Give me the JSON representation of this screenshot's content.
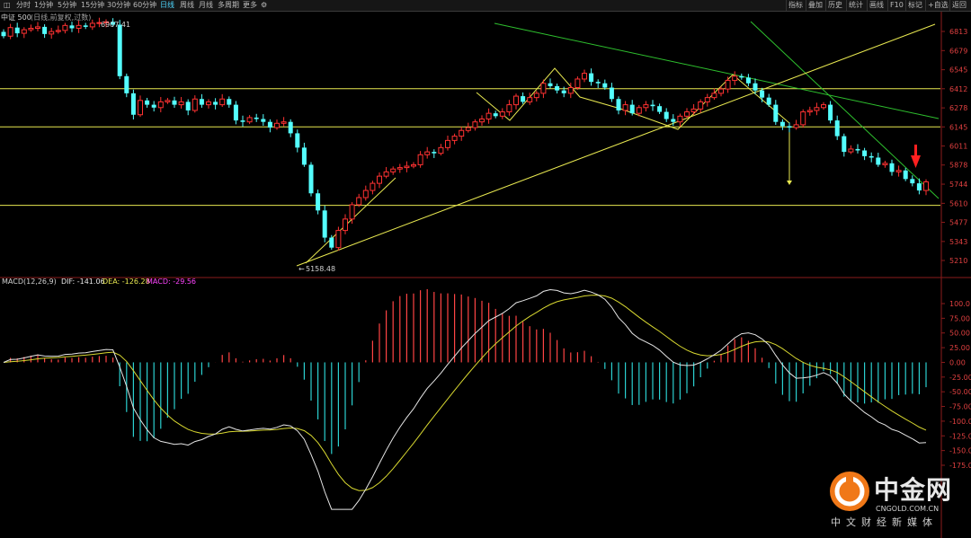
{
  "toolbar": {
    "left_icon": "window-icon",
    "tabs": [
      "分时",
      "1分钟",
      "5分钟",
      "15分钟",
      "30分钟",
      "60分钟",
      "日线",
      "周线",
      "月线",
      "多周期",
      "更多"
    ],
    "active_tab": "日线",
    "settings_icon": "gear-icon",
    "right_tabs": [
      "指标",
      "叠加",
      "历史",
      "统计",
      "画线",
      "F10",
      "标记",
      "+自选",
      "返回"
    ]
  },
  "colors": {
    "up": "#ff3232",
    "down": "#54ffff",
    "ma_line": "#e8e850",
    "trend_green": "#2ec02e",
    "white_line": "#e6e6e6",
    "grid": "#8b1b1b"
  },
  "price_panel": {
    "title": "中证 500",
    "subtitle": "(日线,前复权,过数)",
    "high_label": "6907.41",
    "low_label": "5158.48",
    "y_ticks": [
      6813,
      6679,
      6545,
      6412,
      6278,
      6145,
      6011,
      5878,
      5744,
      5610,
      5477,
      5343,
      5210
    ],
    "horizontal_levels": [
      6412,
      6145,
      5596
    ]
  },
  "macd_panel": {
    "params": "MACD(12,26,9)",
    "dif_label": "DIF: -141.06",
    "dea_label": "DEA: -126.28",
    "macd_label": "MACD: -29.56",
    "y_ticks": [
      "100.0",
      "75.00",
      "50.00",
      "25.00",
      "0.00",
      "-25.00",
      "-50.00",
      "-75.00",
      "-100.0",
      "-125.0",
      "-150.0",
      "-175.0"
    ]
  },
  "logo": {
    "name": "中金网",
    "domain": "CNGOLD.COM.CN",
    "tagline": "中文财经新媒体"
  },
  "chart_data": {
    "type": "candlestick",
    "y_range": [
      5140,
      6900
    ],
    "close": [
      6780,
      6840,
      6800,
      6825,
      6835,
      6845,
      6795,
      6812,
      6820,
      6855,
      6835,
      6855,
      6845,
      6870,
      6875,
      6880,
      6860,
      6500,
      6380,
      6230,
      6330,
      6300,
      6280,
      6320,
      6330,
      6300,
      6320,
      6260,
      6340,
      6300,
      6320,
      6300,
      6340,
      6300,
      6190,
      6180,
      6210,
      6200,
      6180,
      6140,
      6170,
      6180,
      6100,
      6000,
      5880,
      5680,
      5560,
      5370,
      5300,
      5420,
      5500,
      5600,
      5650,
      5700,
      5750,
      5800,
      5830,
      5850,
      5860,
      5870,
      5880,
      5950,
      5970,
      5960,
      6000,
      6050,
      6080,
      6120,
      6140,
      6180,
      6200,
      6240,
      6220,
      6250,
      6300,
      6360,
      6320,
      6350,
      6380,
      6450,
      6430,
      6400,
      6380,
      6420,
      6480,
      6520,
      6460,
      6450,
      6420,
      6340,
      6260,
      6300,
      6240,
      6280,
      6300,
      6290,
      6250,
      6200,
      6180,
      6220,
      6250,
      6270,
      6320,
      6350,
      6380,
      6410,
      6470,
      6500,
      6490,
      6450,
      6400,
      6350,
      6300,
      6180,
      6150,
      6140,
      6160,
      6250,
      6260,
      6280,
      6300,
      6190,
      6080,
      5970,
      5990,
      5980,
      5940,
      5930,
      5880,
      5890,
      5830,
      5840,
      5780,
      5750,
      5700,
      5760
    ]
  }
}
